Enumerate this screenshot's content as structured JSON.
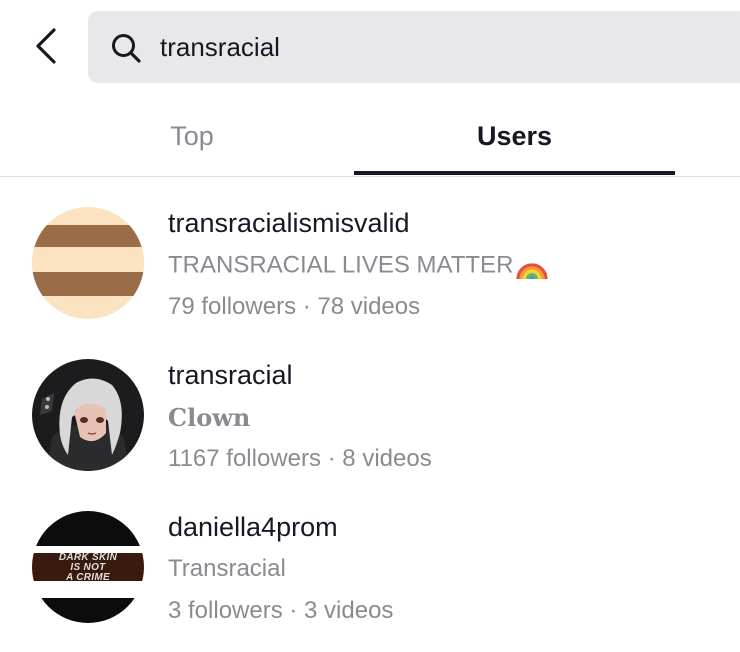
{
  "search": {
    "query": "transracial"
  },
  "tabs": [
    {
      "label": "Top"
    },
    {
      "label": "Users"
    }
  ],
  "users": [
    {
      "username": "transracialismisvalid",
      "bio": "TRANSRACIAL LIVES MATTER",
      "bio_emoji": "rainbow",
      "stats": "79 followers · 78 videos",
      "avatar": "brown-beige-stripes"
    },
    {
      "username": "transracial",
      "bio": "Clown",
      "stats": "1167 followers · 8 videos",
      "avatar": "anime-character"
    },
    {
      "username": "daniella4prom",
      "bio": "Transracial",
      "stats": "3 followers · 3 videos",
      "avatar": "black-white-stripes",
      "avatar_text": [
        "DARK SKIN",
        "IS NOT",
        "A CRIME"
      ]
    }
  ],
  "colors": {
    "primary_text": "#161823",
    "secondary_text": "#8a8b91",
    "search_bg": "#e8e8ea",
    "divider": "#dedede"
  }
}
